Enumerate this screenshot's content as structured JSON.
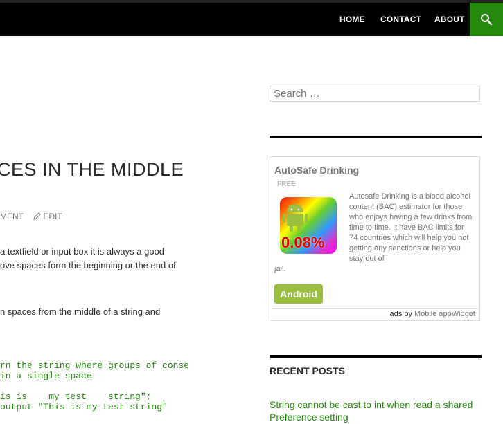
{
  "nav": {
    "items": [
      "HOME",
      "CONTACT",
      "ABOUT"
    ]
  },
  "article": {
    "title": "CES IN THE MIDDLE",
    "meta_comment": "MENT",
    "meta_edit": "EDIT",
    "para1": [
      "a textfield or input box it is always a good",
      "ove spaces form the beginning or the end of"
    ],
    "para2": "n spaces from the middle of a string and",
    "code1": [
      "rn the string where groups of conse",
      "in a single space"
    ],
    "code2": [
      "is is    my test    string\";",
      "output \"This is my test string\""
    ]
  },
  "sidebar": {
    "search_placeholder": "Search …",
    "ad": {
      "title": "AutoSafe Drinking",
      "free": "FREE",
      "percent": "0.08%",
      "description": "Autosafe Drinking is a blood alcohol content (BAC) estimator for those who enjoys having a few drinks from time to time. It have BAC limits for 74 countries which will help you not getting any sanctions or help you stay out of",
      "description_tail": "jail.",
      "button": "Android",
      "footer_prefix": "ads by",
      "footer_link": "Mobile appWidget"
    },
    "recent_posts_title": "RECENT POSTS",
    "recent_posts": [
      "String cannot be cast to int when read a shared Preference setting"
    ]
  },
  "colors": {
    "accent": "#24890d",
    "android_green": "#9bbf3f",
    "topbar": "#000000"
  }
}
